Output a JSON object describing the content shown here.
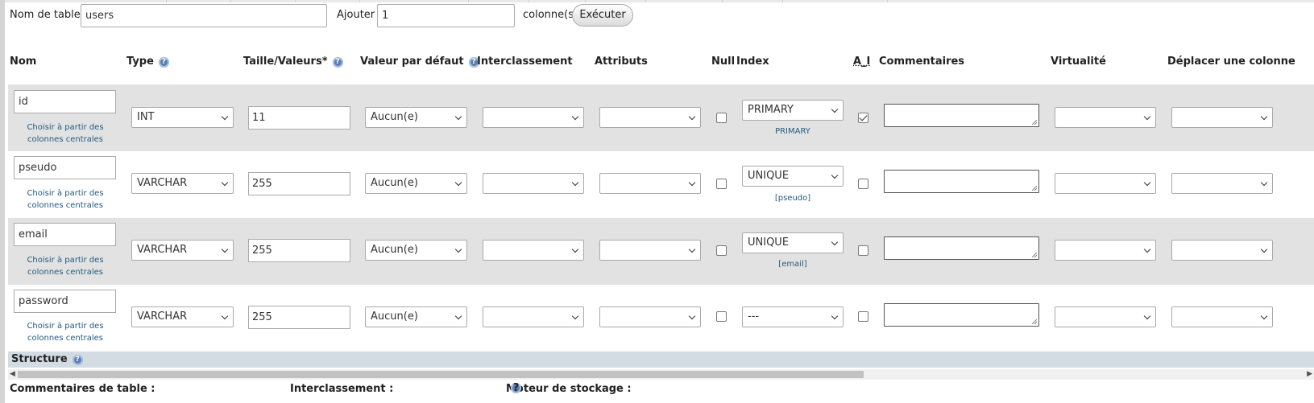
{
  "top": {
    "table_name_label": "Nom de table:",
    "table_name_value": "users",
    "add_label": "Ajouter",
    "add_value": "1",
    "columns_label": "colonne(s)",
    "execute_button": "Exécuter"
  },
  "headers": {
    "nom": "Nom",
    "type": "Type",
    "taille": "Taille/Valeurs*",
    "defaut": "Valeur par défaut",
    "interclassement": "Interclassement",
    "attributs": "Attributs",
    "null": "Null",
    "index": "Index",
    "ai": "A_I",
    "commentaires": "Commentaires",
    "virtualite": "Virtualité",
    "deplacer": "Déplacer une colonne"
  },
  "central_link": "Choisir à partir des colonnes centrales",
  "rows": [
    {
      "name": "id",
      "type": "INT",
      "length": "11",
      "default": "Aucun(e)",
      "index": "PRIMARY",
      "index_note": "PRIMARY",
      "ai": true
    },
    {
      "name": "pseudo",
      "type": "VARCHAR",
      "length": "255",
      "default": "Aucun(e)",
      "index": "UNIQUE",
      "index_note": "[pseudo]",
      "ai": false
    },
    {
      "name": "email",
      "type": "VARCHAR",
      "length": "255",
      "default": "Aucun(e)",
      "index": "UNIQUE",
      "index_note": "[email]",
      "ai": false
    },
    {
      "name": "password",
      "type": "VARCHAR",
      "length": "255",
      "default": "Aucun(e)",
      "index": "---",
      "index_note": "",
      "ai": false
    }
  ],
  "structure_label": "Structure",
  "bottom": {
    "comments_label": "Commentaires de table :",
    "collation_label": "Interclassement :",
    "engine_label": "Moteur de stockage :"
  },
  "colors": {
    "row_alt": "#e2e2e2",
    "structure_bar": "#d3dce3",
    "link": "#235a81",
    "help_icon": "#5b7fb3"
  }
}
